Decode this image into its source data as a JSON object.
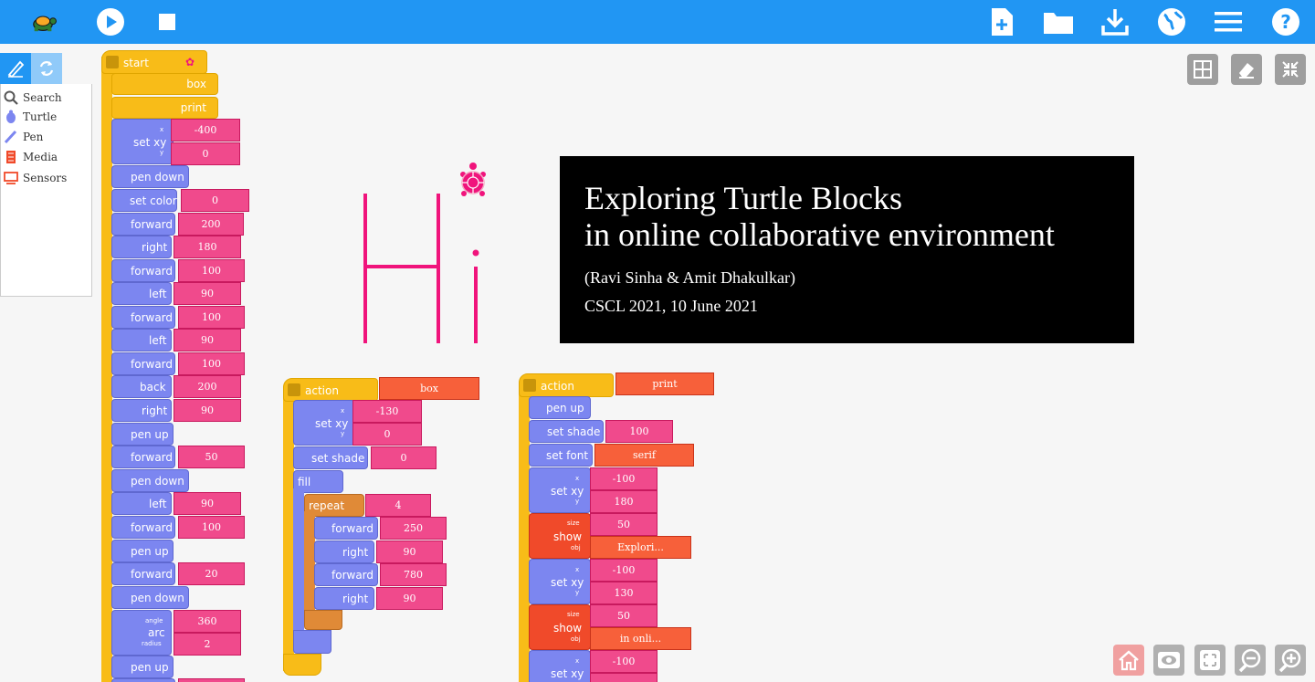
{
  "toolbar": {
    "bg": "#2196f3",
    "left_icons": [
      "turtle-logo-icon",
      "play-icon",
      "stop-icon"
    ],
    "right_icons": [
      "new-project-icon",
      "open-folder-icon",
      "download-icon",
      "globe-icon",
      "menu-icon",
      "help-icon"
    ]
  },
  "palette": {
    "items": [
      {
        "label": "Search",
        "icon": "search-icon"
      },
      {
        "label": "Turtle",
        "icon": "turtle-icon"
      },
      {
        "label": "Pen",
        "icon": "pen-icon"
      },
      {
        "label": "Media",
        "icon": "media-icon"
      },
      {
        "label": "Sensors",
        "icon": "sensors-icon"
      }
    ]
  },
  "start_stack": {
    "hat": "start",
    "blocks": [
      {
        "label": "box"
      },
      {
        "label": "print"
      },
      {
        "label": "set xy",
        "x_label": "x",
        "y_label": "y",
        "x": "-400",
        "y": "0"
      },
      {
        "label": "pen down"
      },
      {
        "label": "set color",
        "arg": "0"
      },
      {
        "label": "forward",
        "arg": "200"
      },
      {
        "label": "right",
        "arg": "180"
      },
      {
        "label": "forward",
        "arg": "100"
      },
      {
        "label": "left",
        "arg": "90"
      },
      {
        "label": "forward",
        "arg": "100"
      },
      {
        "label": "left",
        "arg": "90"
      },
      {
        "label": "forward",
        "arg": "100"
      },
      {
        "label": "back",
        "arg": "200"
      },
      {
        "label": "right",
        "arg": "90"
      },
      {
        "label": "pen up"
      },
      {
        "label": "forward",
        "arg": "50"
      },
      {
        "label": "pen down"
      },
      {
        "label": "left",
        "arg": "90"
      },
      {
        "label": "forward",
        "arg": "100"
      },
      {
        "label": "pen up"
      },
      {
        "label": "forward",
        "arg": "20"
      },
      {
        "label": "pen down"
      },
      {
        "label": "arc",
        "angle_label": "angle",
        "radius_label": "radius",
        "angle": "360",
        "radius": "2"
      },
      {
        "label": "pen up"
      }
    ]
  },
  "box_action": {
    "hat": "action",
    "name": "box",
    "setxy": {
      "label": "set xy",
      "x_label": "x",
      "y_label": "y",
      "x": "-130",
      "y": "0"
    },
    "setshade": {
      "label": "set shade",
      "arg": "0"
    },
    "fill": "fill",
    "repeat": {
      "label": "repeat",
      "arg": "4"
    },
    "inner": [
      {
        "label": "forward",
        "arg": "250"
      },
      {
        "label": "right",
        "arg": "90"
      },
      {
        "label": "forward",
        "arg": "780"
      },
      {
        "label": "right",
        "arg": "90"
      }
    ]
  },
  "print_action": {
    "hat": "action",
    "name": "print",
    "penup": "pen up",
    "setshade": {
      "label": "set shade",
      "arg": "100"
    },
    "setfont": {
      "label": "set font",
      "arg": "serif"
    },
    "setxy1": {
      "label": "set xy",
      "x_label": "x",
      "y_label": "y",
      "x": "-100",
      "y": "180"
    },
    "show1": {
      "label": "show",
      "size_label": "size",
      "obj_label": "obj",
      "size": "50",
      "obj": "Explori..."
    },
    "setxy2": {
      "label": "set xy",
      "x_label": "x",
      "y_label": "y",
      "x": "-100",
      "y": "130"
    },
    "show2": {
      "label": "show",
      "size_label": "size",
      "obj_label": "obj",
      "size": "50",
      "obj": "in onli..."
    },
    "setxy3": {
      "label": "set xy",
      "x_label": "x",
      "x": "-100"
    }
  },
  "slide": {
    "title_line1": "Exploring Turtle Blocks",
    "title_line2": "in online collaborative environment",
    "authors": "(Ravi Sinha & Amit Dhakulkar)",
    "event": "CSCL 2021,  10 June 2021"
  },
  "canvas_tools": [
    "grid-icon",
    "eraser-icon",
    "collapse-icon"
  ],
  "bottom_tools": [
    "home-icon",
    "eye-icon",
    "fit-icon",
    "zoom-out-icon",
    "zoom-in-icon"
  ],
  "colors": {
    "drawing": "#f0147c",
    "flow": "#f8bc18",
    "motion": "#7c86f0",
    "number": "#f04a8c",
    "media": "#f04a2a",
    "repeat": "#e08a37"
  }
}
